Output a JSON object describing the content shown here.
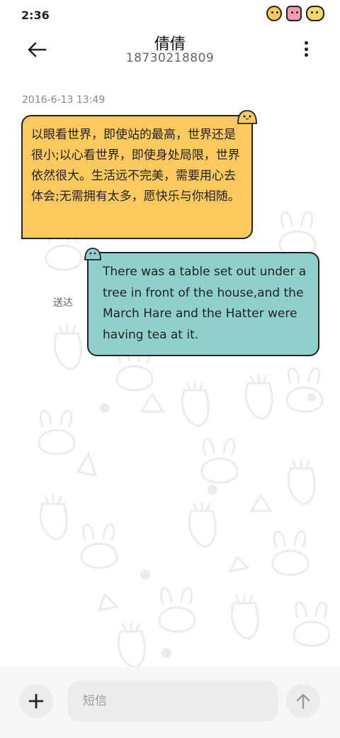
{
  "status_bar": {
    "time": "2:36",
    "icons": [
      "cartoon-sun-icon",
      "cartoon-bunny-icon",
      "cartoon-face-icon"
    ]
  },
  "header": {
    "title": "倩倩",
    "phone": "18730218809",
    "back_icon": "arrow-left-icon",
    "more_icon": "more-vertical-icon"
  },
  "conversation": {
    "timestamp": "2016-6-13 13:49",
    "messages": [
      {
        "direction": "incoming",
        "text": "以眼看世界，即使站的最高，世界还是很小;以心看世界，即使身处局限，世界依然很大。生活远不完美，需要用心去体会;无需拥有太多，愿快乐与你相随。",
        "bubble_color": "#fbc95e"
      },
      {
        "direction": "outgoing",
        "text": "There was a table set out under a tree in front of the house,and the March Hare and the Hatter were having tea at it.",
        "status": "送达",
        "bubble_color": "#8fd0cc"
      }
    ]
  },
  "composer": {
    "placeholder": "短信",
    "add_icon": "plus-icon",
    "send_icon": "arrow-up-icon"
  }
}
